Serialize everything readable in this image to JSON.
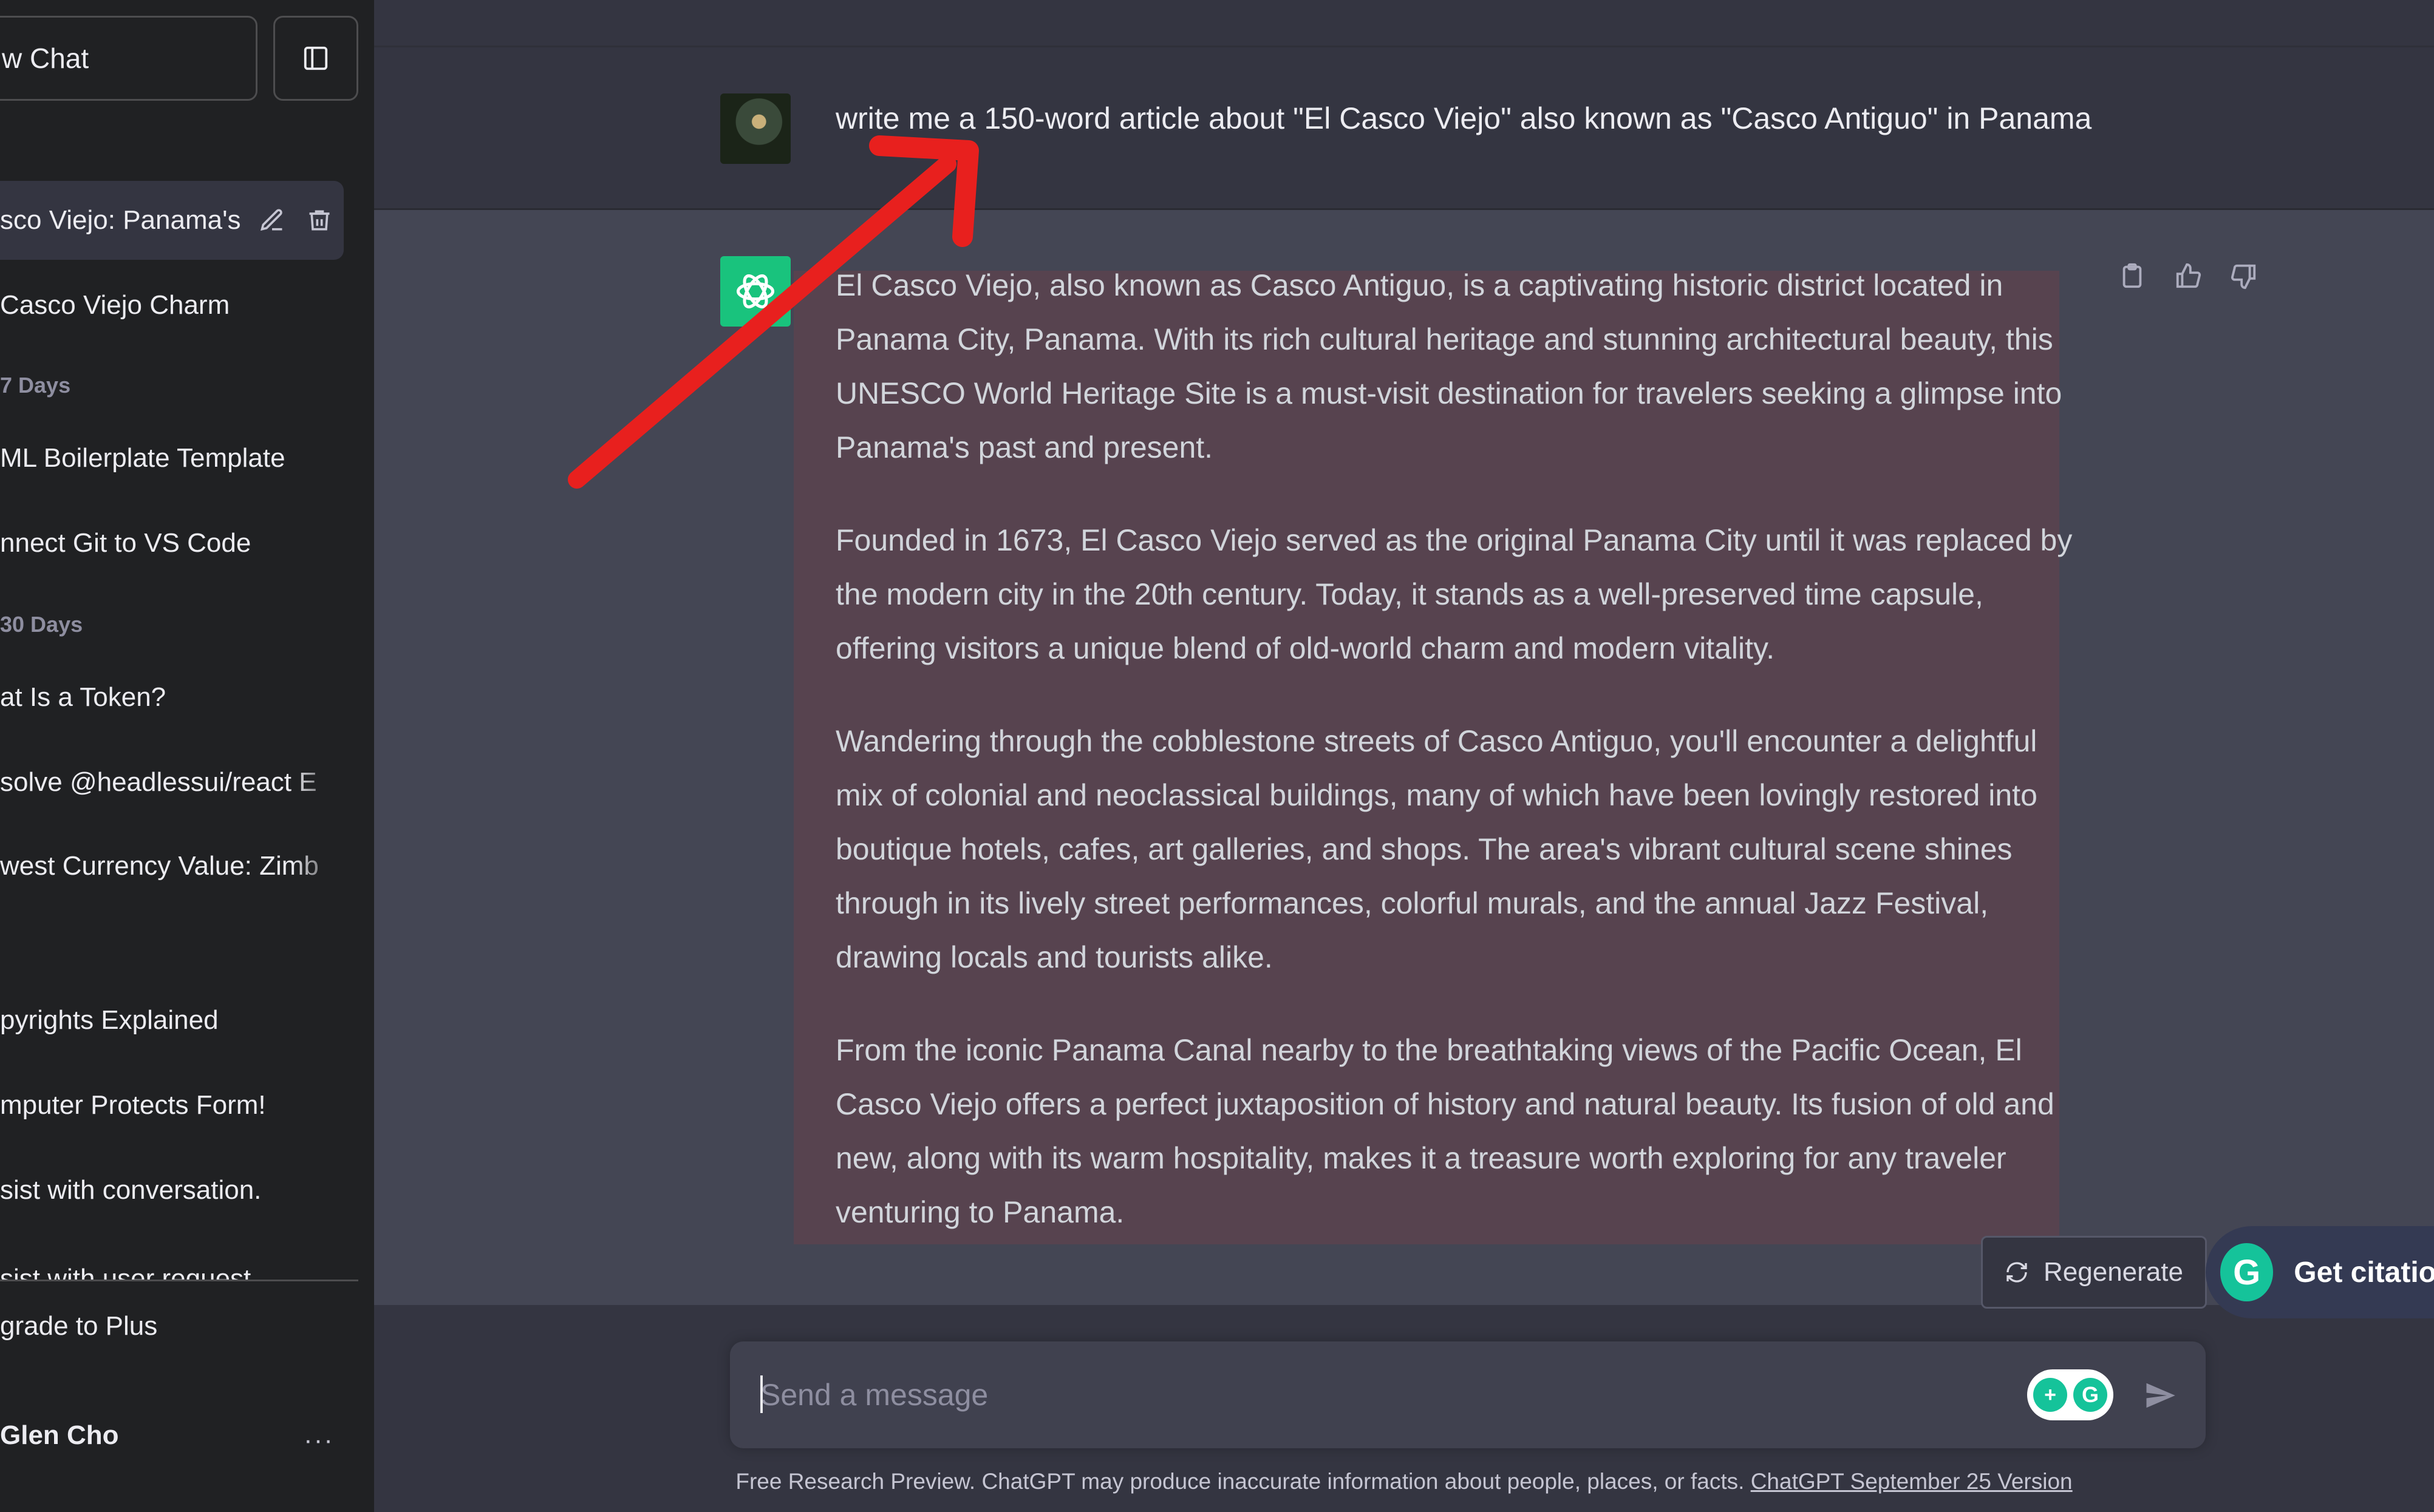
{
  "sidebar": {
    "new_chat_label": "w Chat",
    "items": [
      {
        "label": "sco Viejo: Panama's",
        "active": true
      },
      {
        "label": "Casco Viejo Charm"
      },
      {
        "label": "ML Boilerplate Template"
      },
      {
        "label": "nnect Git to VS Code"
      },
      {
        "label": "at Is a Token?"
      },
      {
        "label": "solve @headlessui/react E"
      },
      {
        "label": "west Currency Value: Zimb"
      },
      {
        "label": "pyrights Explained"
      },
      {
        "label": "mputer Protects Form!"
      },
      {
        "label": "sist with conversation."
      },
      {
        "label": "sist with user request"
      }
    ],
    "sections": [
      "7 Days",
      "30 Days"
    ],
    "upgrade_label": "grade to Plus",
    "user_name": "Glen Cho",
    "more_label": "···"
  },
  "conversation": {
    "user_message": "write me a 150-word article about \"El Casco Viejo\" also known as \"Casco Antiguo\" in Panama",
    "assistant_paragraphs": [
      "El Casco Viejo, also known as Casco Antiguo, is a captivating historic district located in Panama City, Panama. With its rich cultural heritage and stunning architectural beauty, this UNESCO World Heritage Site is a must-visit destination for travelers seeking a glimpse into Panama's past and present.",
      "Founded in 1673, El Casco Viejo served as the original Panama City until it was replaced by the modern city in the 20th century. Today, it stands as a well-preserved time capsule, offering visitors a unique blend of old-world charm and modern vitality.",
      "Wandering through the cobblestone streets of Casco Antiguo, you'll encounter a delightful mix of colonial and neoclassical buildings, many of which have been lovingly restored into boutique hotels, cafes, art galleries, and shops. The area's vibrant cultural scene shines through in its lively street performances, colorful murals, and the annual Jazz Festival, drawing locals and tourists alike.",
      "From the iconic Panama Canal nearby to the breathtaking views of the Pacific Ocean, El Casco Viejo offers a perfect juxtaposition of history and natural beauty. Its fusion of old and new, along with its warm hospitality, makes it a treasure worth exploring for any traveler venturing to Panama."
    ]
  },
  "actions": {
    "regenerate_label": "Regenerate",
    "grammarly_cta": "Get citatio"
  },
  "composer": {
    "placeholder": "Send a message",
    "value": ""
  },
  "footer": {
    "text": "Free Research Preview. ChatGPT may produce inaccurate information about people, places, or facts.",
    "link": "ChatGPT September 25 Version"
  },
  "colors": {
    "sidebar_bg": "#202123",
    "main_bg": "#343541",
    "assistant_bg": "#444654",
    "highlight": "#57434f",
    "gpt_green": "#19c37d",
    "grammarly_green": "#15c39a",
    "annotation_arrow": "#e8201e"
  },
  "icons": [
    "sidebar-toggle-icon",
    "edit-icon",
    "trash-icon",
    "user-avatar",
    "chatgpt-logo-icon",
    "copy-icon",
    "thumbs-up-icon",
    "thumbs-down-icon",
    "refresh-icon",
    "grammarly-icon",
    "send-icon",
    "annotation-arrow"
  ]
}
